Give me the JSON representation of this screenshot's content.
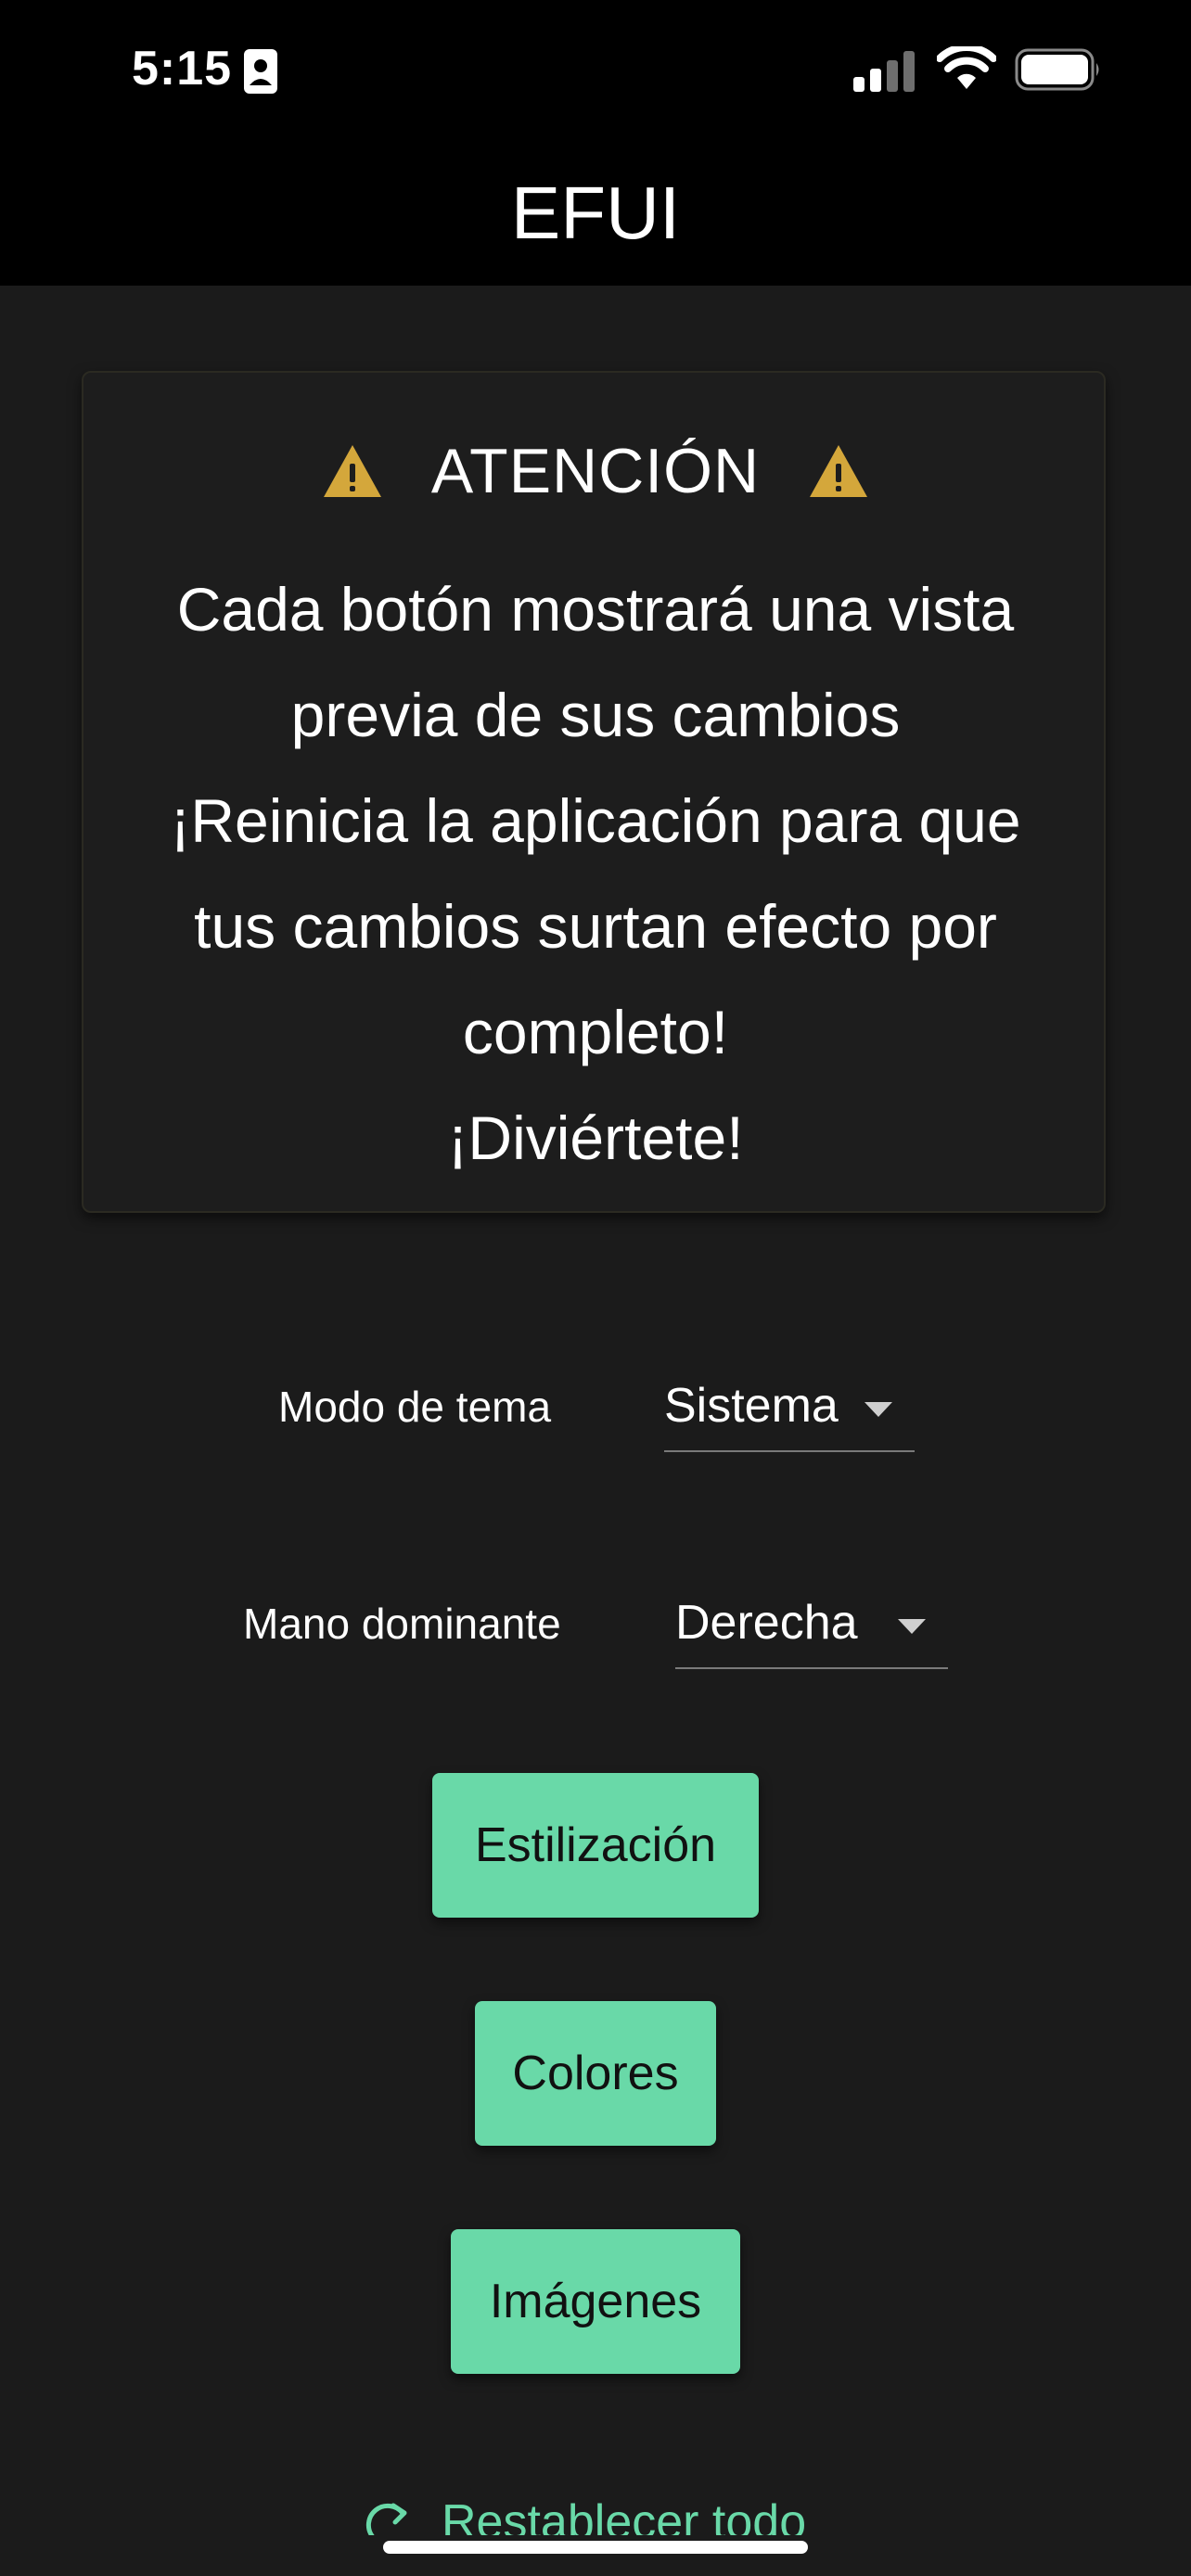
{
  "status_bar": {
    "time": "5:15"
  },
  "header": {
    "title": "EFUI"
  },
  "warning": {
    "title": "ATENCIÓN",
    "lines": [
      "Cada botón mostrará una vista",
      "previa de sus cambios",
      "¡Reinicia la aplicación para que",
      "tus cambios surtan efecto por",
      "completo!",
      "¡Diviértete!"
    ],
    "icon_color": "#d4a73b"
  },
  "settings": {
    "theme_mode": {
      "label": "Modo de tema",
      "value": "Sistema"
    },
    "dominant_hand": {
      "label": "Mano dominante",
      "value": "Derecha"
    }
  },
  "buttons": {
    "styling": "Estilización",
    "colors": "Colores",
    "images": "Imágenes"
  },
  "reset": {
    "label": "Restablecer todo"
  },
  "theme": {
    "accent": "#69d9a8",
    "background": "#1b1b1b",
    "header_background": "#000000",
    "warning_icon": "#d4a73b"
  }
}
